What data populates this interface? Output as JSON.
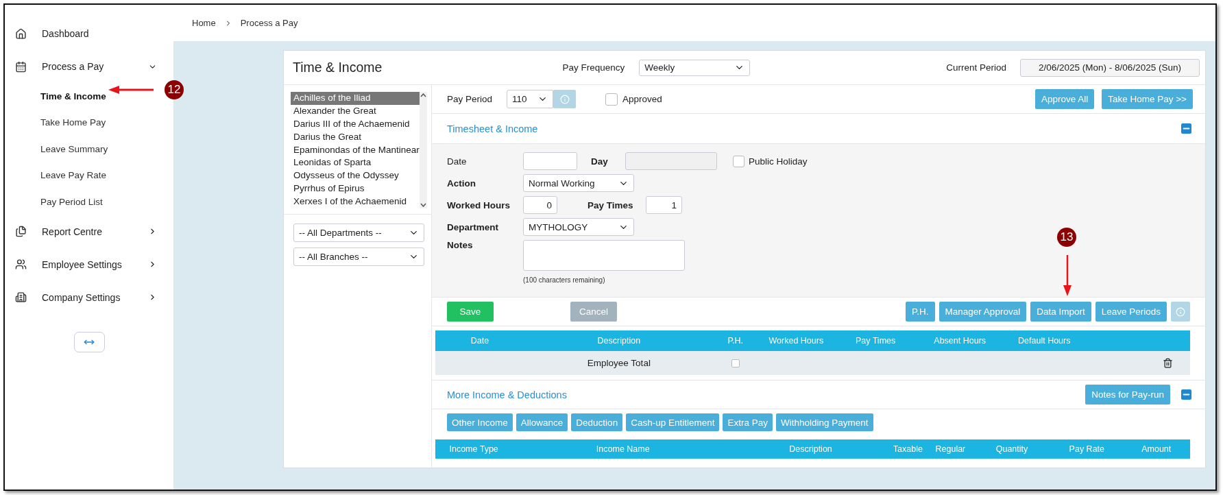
{
  "breadcrumb": [
    "Home",
    "Process a Pay"
  ],
  "sidebar": {
    "items": [
      {
        "label": "Dashboard"
      },
      {
        "label": "Process a Pay",
        "expanded": true,
        "children": [
          {
            "label": "Time & Income",
            "selected": true
          },
          {
            "label": "Take Home Pay",
            "selected": false
          },
          {
            "label": "Leave Summary",
            "selected": false
          },
          {
            "label": "Leave Pay Rate",
            "selected": false
          },
          {
            "label": "Pay Period List",
            "selected": false
          }
        ]
      },
      {
        "label": "Report Centre",
        "expanded": false
      },
      {
        "label": "Employee Settings",
        "expanded": false
      },
      {
        "label": "Company Settings",
        "expanded": false
      }
    ]
  },
  "title": "Time & Income",
  "pay_frequency": {
    "label": "Pay Frequency",
    "value": "Weekly"
  },
  "current_period": {
    "label": "Current Period",
    "value": "2/06/2025 (Mon) - 8/06/2025 (Sun)"
  },
  "employees": [
    {
      "name": "Achilles of the Iliad",
      "selected": true
    },
    {
      "name": "Alexander the Great",
      "selected": false
    },
    {
      "name": "Darius III of the Achaemenid",
      "selected": false
    },
    {
      "name": "Darius the Great",
      "selected": false
    },
    {
      "name": "Epaminondas of the Mantinear",
      "selected": false
    },
    {
      "name": "Leonidas of Sparta",
      "selected": false
    },
    {
      "name": "Odysseus of the Odyssey",
      "selected": false
    },
    {
      "name": "Pyrrhus of Epirus",
      "selected": false
    },
    {
      "name": "Xerxes I of the Achaemenid",
      "selected": false
    }
  ],
  "filters": [
    "-- All Departments --",
    "-- All Branches --"
  ],
  "pay_period": {
    "label": "Pay Period",
    "value": "110"
  },
  "approved": {
    "label": "Approved",
    "checked": false
  },
  "top_buttons": [
    "Approve All",
    "Take Home Pay >>"
  ],
  "timesheet": {
    "title": "Timesheet & Income",
    "expanded": true,
    "date_label": "Date",
    "day_label": "Day",
    "public_holiday": {
      "label": "Public Holiday",
      "checked": false
    },
    "action": {
      "label": "Action",
      "value": "Normal Working"
    },
    "worked_hours": {
      "label": "Worked Hours",
      "value": "0"
    },
    "pay_times": {
      "label": "Pay Times",
      "value": "1"
    },
    "department": {
      "label": "Department",
      "value": "MYTHOLOGY"
    },
    "notes": {
      "label": "Notes",
      "hint": "(100 characters remaining)"
    }
  },
  "form_buttons": [
    {
      "label": "Save",
      "kind": "save"
    },
    {
      "label": "Cancel",
      "kind": "cancel"
    }
  ],
  "action_buttons": [
    "P.H.",
    "Manager Approval",
    "Data Import",
    "Leave Periods"
  ],
  "timesheet_table": {
    "columns": [
      "Date",
      "Description",
      "P.H.",
      "Worked Hours",
      "Pay Times",
      "Absent Hours",
      "Default Hours"
    ],
    "rows": [
      {
        "description": "Employee Total",
        "ph": false
      }
    ]
  },
  "more_income": {
    "title": "More Income & Deductions",
    "expanded": true,
    "notes_button": "Notes for Pay-run",
    "tabs": [
      "Other Income",
      "Allowance",
      "Deduction",
      "Cash-up Entitlement",
      "Extra Pay",
      "Withholding Payment"
    ],
    "columns": [
      "Income Type",
      "Income Name",
      "Description",
      "Taxable",
      "Regular",
      "Quantity",
      "Pay Rate",
      "Amount"
    ]
  },
  "callouts": [
    {
      "number": "12"
    },
    {
      "number": "13"
    }
  ]
}
